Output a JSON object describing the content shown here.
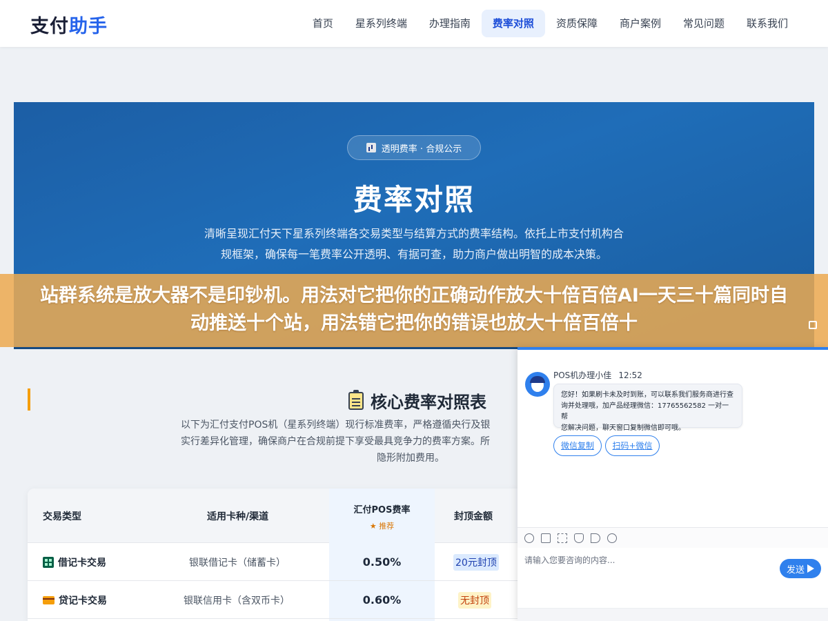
{
  "header": {
    "logo_part1": "支付",
    "logo_part2": "助手",
    "nav": [
      "首页",
      "星系列终端",
      "办理指南",
      "费率对照",
      "资质保障",
      "商户案例",
      "常见问题",
      "联系我们"
    ],
    "active_nav": "费率对照"
  },
  "hero": {
    "badge": "透明费率 · 合规公示",
    "title": "费率对照",
    "desc_line1": "清晰呈现汇付天下星系列终端各交易类型与结算方式的费率结构。依托上市支付机构合",
    "desc_line2": "规框架，确保每一笔费率公开透明、有据可查，助力商户做出明智的成本决策。"
  },
  "banner": {
    "text": "站群系统是放大器不是印钞机。用法对它把你的正确动作放大十倍百倍AI一天三十篇同时自动推送十个站，用法错它把你的错误也放大十倍百倍十"
  },
  "section": {
    "title": "核心费率对照表",
    "desc_line1": "以下为汇付支付POS机（星系列终端）现行标准费率，严格遵循央行及银",
    "desc_line2": "实行差异化管理，确保商户在合规前提下享受最具竞争力的费率方案。所",
    "desc_line3": "隐形附加费用。"
  },
  "table": {
    "headers": {
      "type": "交易类型",
      "card": "适用卡种/渠道",
      "rate": "汇付POS费率",
      "rate_badge": "★ 推荐",
      "cap": "封顶金额"
    },
    "rows": [
      {
        "type": "借记卡交易",
        "card": "银联借记卡（储蓄卡）",
        "rate": "0.50%",
        "cap": "20元封顶"
      },
      {
        "type": "贷记卡交易",
        "card": "银联信用卡（含双币卡）",
        "rate": "0.60%",
        "cap": "无封顶"
      }
    ]
  },
  "chat": {
    "agent_name": "POS机办理小佳",
    "time": "12:52",
    "message_line1": "您好！如果刷卡未及时到账，可以联系我们服务商进行查",
    "message_line2": "询并处理哦，加产品经理微信：17765562582 一对一帮",
    "message_line3": "您解决问题，聊天窗口复制微信即可哦。",
    "btn_copy": "微信复制",
    "btn_scan": "扫码+微信",
    "input_placeholder": "请输入您要咨询的内容...",
    "send_label": "发送"
  }
}
